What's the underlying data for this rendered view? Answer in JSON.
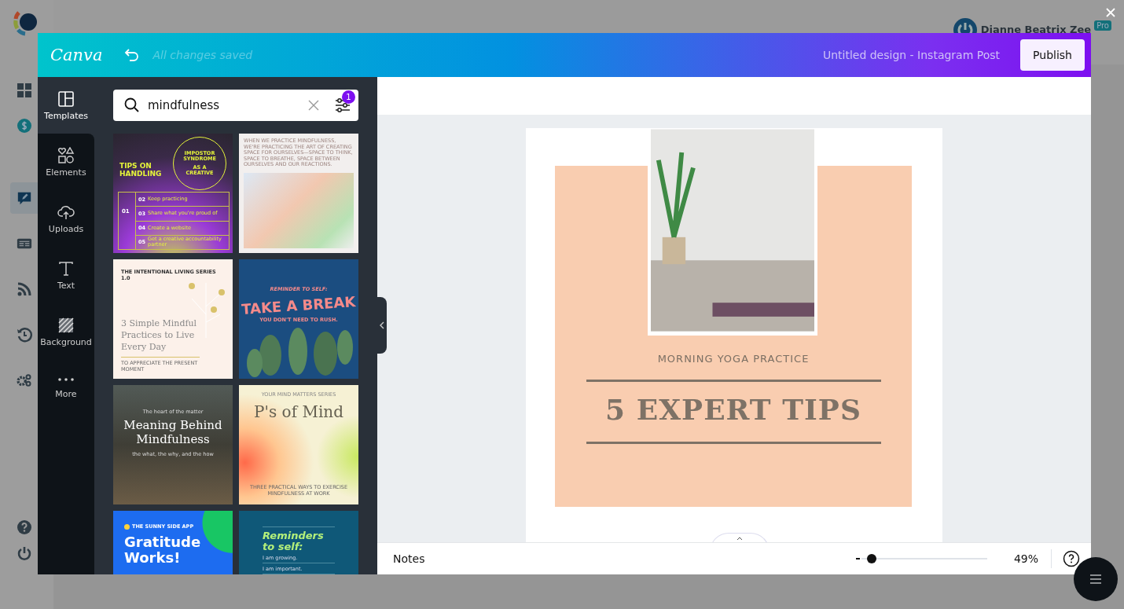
{
  "app": {
    "user_name": "Dianne Beatrix Zee",
    "badge": "Pro",
    "rail_top": [
      {
        "kind": "dashboard",
        "selected": false
      },
      {
        "kind": "billing",
        "selected": false
      },
      {
        "kind": "editor",
        "selected": true
      },
      {
        "kind": "news",
        "selected": false
      },
      {
        "kind": "feed",
        "selected": false
      },
      {
        "kind": "history",
        "selected": false
      },
      {
        "kind": "settings",
        "selected": false
      }
    ],
    "rail_bottom": [
      {
        "kind": "help",
        "selected": false
      },
      {
        "kind": "power",
        "selected": false
      }
    ]
  },
  "editor": {
    "logo": "Canva",
    "save_status": "All changes saved",
    "title": "Untitled design - Instagram Post",
    "publish": "Publish"
  },
  "nav": [
    {
      "kind": "templates",
      "label": "Templates",
      "selected": true
    },
    {
      "kind": "elements",
      "label": "Elements",
      "selected": false
    },
    {
      "kind": "uploads",
      "label": "Uploads",
      "selected": false
    },
    {
      "kind": "text",
      "label": "Text",
      "selected": false
    },
    {
      "kind": "background",
      "label": "Background",
      "selected": false
    },
    {
      "kind": "more",
      "label": "More",
      "selected": false
    }
  ],
  "search": {
    "value": "mindfulness",
    "filter_count": "1"
  },
  "templates": [
    {
      "kind": "impostor",
      "title": "TIPS ON HANDLING",
      "circle_top": "IMPOSTOR SYNDROME",
      "circle_bottom": "AS A CREATIVE",
      "first": "01",
      "steps": [
        {
          "number": "02",
          "text": "Keep practicing"
        },
        {
          "number": "03",
          "text": "Share what you're proud of"
        },
        {
          "number": "04",
          "text": "Create a website"
        },
        {
          "number": "05",
          "text": "Get a creative accountability partner"
        }
      ]
    },
    {
      "kind": "quote",
      "text": "WHEN WE PRACTICE MINDFULNESS, WE'RE PRACTICING THE ART OF CREATING SPACE FOR OURSELVES—SPACE TO THINK, SPACE TO BREATHE, SPACE BETWEEN OURSELVES AND OUR REACTIONS."
    },
    {
      "kind": "series",
      "series": "THE INTENTIONAL LIVING SERIES 1.0",
      "title": "3 Simple Mindful Practices to Live Every Day",
      "footer": "TO APPRECIATE THE PRESENT MOMENT"
    },
    {
      "kind": "break",
      "kicker": "REMINDER TO SELF:",
      "title": "TAKE A BREAK",
      "subtitle": "YOU DON'T NEED TO RUSH."
    },
    {
      "kind": "meaning",
      "kicker": "The heart of the matter",
      "title": "Meaning Behind Mindfulness",
      "subtitle": "the what, the why, and the how"
    },
    {
      "kind": "mind",
      "series": "YOUR MIND MATTERS SERIES",
      "title": "P's of Mind",
      "footer": "THREE PRACTICAL WAYS TO EXERCISE MINDFULNESS AT WORK"
    },
    {
      "kind": "gratitude",
      "brand": "THE SUNNY SIDE APP",
      "title": "Gratitude Works!"
    },
    {
      "kind": "reminders",
      "title": "Reminders to self:",
      "items": [
        "I am growing.",
        "I am important."
      ]
    }
  ],
  "design": {
    "subtitle": "MORNING YOGA PRACTICE",
    "headline": "5 EXPERT TIPS"
  },
  "footer": {
    "notes": "Notes",
    "zoom": {
      "level": 0.08,
      "reading": "49%"
    }
  }
}
